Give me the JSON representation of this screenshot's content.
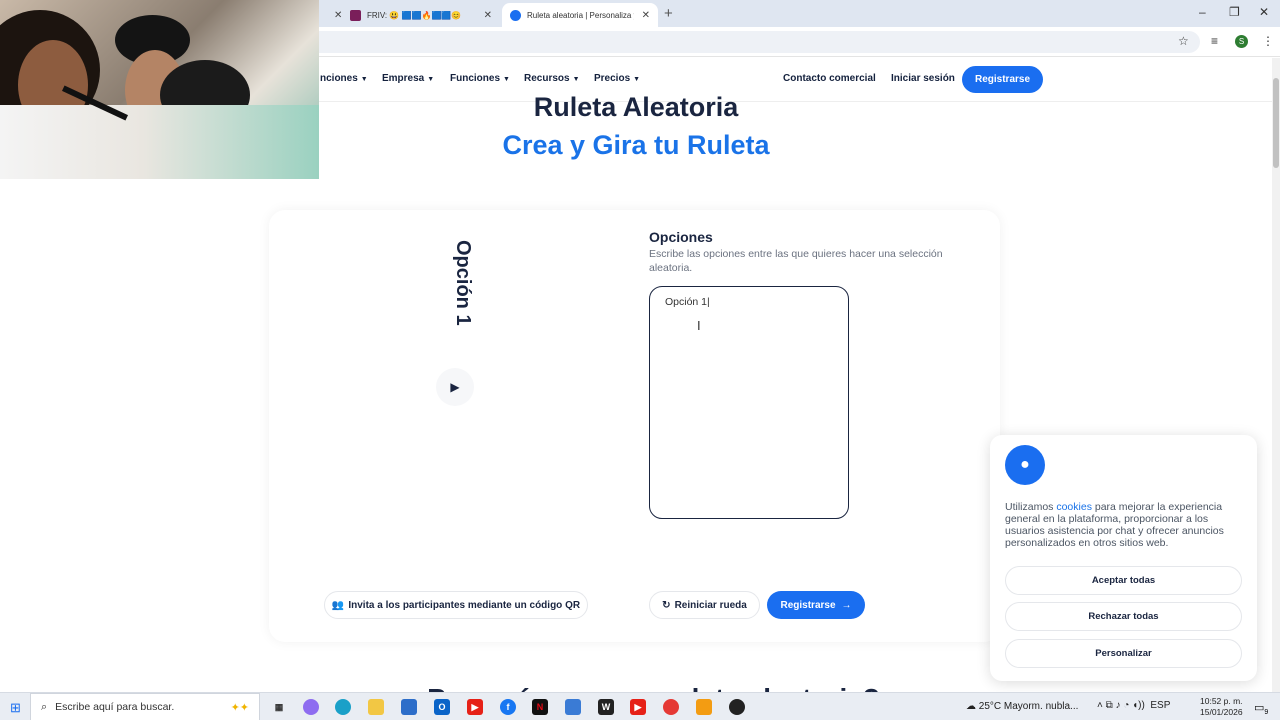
{
  "browser": {
    "tabs": [
      {
        "title": "FRIV: 😃 🟦🟦🔥🟦🟦😊",
        "active": false
      },
      {
        "title": "Ruleta aleatoria | Personaliza y g",
        "active": true
      }
    ],
    "new_tab": "+",
    "window_controls": [
      "–",
      "❐",
      "✕"
    ]
  },
  "nav": {
    "items": [
      "nciones",
      "Empresa",
      "Funciones",
      "Recursos",
      "Precios"
    ],
    "contact": "Contacto comercial",
    "login": "Iniciar sesión",
    "register": "Registrarse"
  },
  "hero": {
    "title": "Ruleta Aleatoria",
    "subtitle": "Crea y Gira tu Ruleta"
  },
  "wheel": {
    "label": "Opción 1"
  },
  "options": {
    "heading": "Opciones",
    "description": "Escribe las opciones entre las que quieres hacer una selección aleatoria.",
    "value": "Opción 1"
  },
  "actions": {
    "qr": "Invita a los participantes mediante un código QR",
    "reset": "Reiniciar rueda",
    "register": "Registrarse"
  },
  "below": {
    "partial_heading": "¿Por qué usar una ruleta aleatoria?"
  },
  "cookies": {
    "text_before": "Utilizamos ",
    "link": "cookies",
    "text_after": " para mejorar la experiencia general en la plataforma, proporcionar a los usuarios asistencia por chat y ofrecer anuncios personalizados en otros sitios web.",
    "accept": "Aceptar todas",
    "reject": "Rechazar todas",
    "customize": "Personalizar"
  },
  "taskbar": {
    "search_placeholder": "Escribe aquí para buscar.",
    "weather": "25°C  Mayorm. nubla...",
    "lang": "ESP",
    "time": "10:52 p. m.",
    "date": "15/01/2026",
    "notifications": "9"
  },
  "colors": {
    "accent": "#1a6ef0",
    "title": "#1a2540",
    "subtitle": "#1a73e8"
  }
}
